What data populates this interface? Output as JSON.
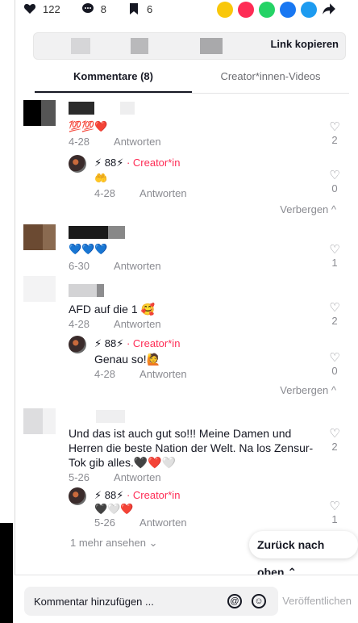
{
  "stats": {
    "likes": "122",
    "comments": "8",
    "saves": "6"
  },
  "link": {
    "copy_label": "Link kopieren"
  },
  "tabs": [
    {
      "label": "Kommentare (8)"
    },
    {
      "label": "Creator*innen-Videos"
    }
  ],
  "comments": [
    {
      "text": "💯💯❤️",
      "date": "4-28",
      "reply_label": "Antworten",
      "likes": "2",
      "replies": [
        {
          "name": "⚡ 88⚡",
          "creator_tag": "· Creator*in",
          "text": "🤲",
          "date": "4-28",
          "reply_label": "Antworten",
          "likes": "0"
        }
      ],
      "hide_label": "Verbergen ^"
    },
    {
      "text": "💙💙💙",
      "date": "6-30",
      "reply_label": "Antworten",
      "likes": "1"
    },
    {
      "text": "AFD auf die 1 🥰",
      "date": "4-28",
      "reply_label": "Antworten",
      "likes": "2",
      "replies": [
        {
          "name": "⚡ 88⚡",
          "creator_tag": "· Creator*in",
          "text": "Genau so!🙋",
          "date": "4-28",
          "reply_label": "Antworten",
          "likes": "0"
        }
      ],
      "hide_label": "Verbergen ^"
    },
    {
      "text_line1": "Und das ist auch gut so!!! Meine Damen und",
      "text_line2": "Herren die beste Nation der Welt. Na los Zensur-",
      "text_line3": "Tok gib alles.🖤❤️🤍",
      "date": "5-26",
      "reply_label": "Antworten",
      "likes": "2",
      "replies": [
        {
          "name": "⚡ 88⚡",
          "creator_tag": "· Creator*in",
          "text": "🖤🤍❤️",
          "date": "5-26",
          "reply_label": "Antworten",
          "likes": "1"
        }
      ]
    }
  ],
  "more_label": "1 mehr ansehen ⌄",
  "back_to_top": "Zurück nach oben ⌃",
  "footer": {
    "placeholder": "Kommentar hinzufügen ...",
    "publish": "Veröffentlichen",
    "at_icon": "@",
    "emoji_icon": "☺"
  },
  "colors": {
    "accent": "#fe2c55",
    "muted": "#8a8b91"
  }
}
